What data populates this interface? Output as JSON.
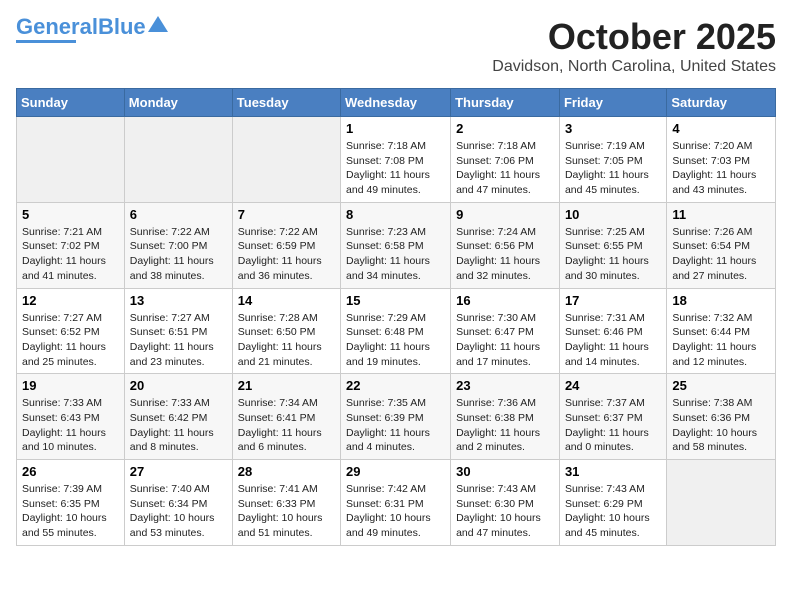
{
  "logo": {
    "part1": "General",
    "part2": "Blue"
  },
  "title": "October 2025",
  "subtitle": "Davidson, North Carolina, United States",
  "weekdays": [
    "Sunday",
    "Monday",
    "Tuesday",
    "Wednesday",
    "Thursday",
    "Friday",
    "Saturday"
  ],
  "weeks": [
    [
      {
        "num": "",
        "info": ""
      },
      {
        "num": "",
        "info": ""
      },
      {
        "num": "",
        "info": ""
      },
      {
        "num": "1",
        "info": "Sunrise: 7:18 AM\nSunset: 7:08 PM\nDaylight: 11 hours and 49 minutes."
      },
      {
        "num": "2",
        "info": "Sunrise: 7:18 AM\nSunset: 7:06 PM\nDaylight: 11 hours and 47 minutes."
      },
      {
        "num": "3",
        "info": "Sunrise: 7:19 AM\nSunset: 7:05 PM\nDaylight: 11 hours and 45 minutes."
      },
      {
        "num": "4",
        "info": "Sunrise: 7:20 AM\nSunset: 7:03 PM\nDaylight: 11 hours and 43 minutes."
      }
    ],
    [
      {
        "num": "5",
        "info": "Sunrise: 7:21 AM\nSunset: 7:02 PM\nDaylight: 11 hours and 41 minutes."
      },
      {
        "num": "6",
        "info": "Sunrise: 7:22 AM\nSunset: 7:00 PM\nDaylight: 11 hours and 38 minutes."
      },
      {
        "num": "7",
        "info": "Sunrise: 7:22 AM\nSunset: 6:59 PM\nDaylight: 11 hours and 36 minutes."
      },
      {
        "num": "8",
        "info": "Sunrise: 7:23 AM\nSunset: 6:58 PM\nDaylight: 11 hours and 34 minutes."
      },
      {
        "num": "9",
        "info": "Sunrise: 7:24 AM\nSunset: 6:56 PM\nDaylight: 11 hours and 32 minutes."
      },
      {
        "num": "10",
        "info": "Sunrise: 7:25 AM\nSunset: 6:55 PM\nDaylight: 11 hours and 30 minutes."
      },
      {
        "num": "11",
        "info": "Sunrise: 7:26 AM\nSunset: 6:54 PM\nDaylight: 11 hours and 27 minutes."
      }
    ],
    [
      {
        "num": "12",
        "info": "Sunrise: 7:27 AM\nSunset: 6:52 PM\nDaylight: 11 hours and 25 minutes."
      },
      {
        "num": "13",
        "info": "Sunrise: 7:27 AM\nSunset: 6:51 PM\nDaylight: 11 hours and 23 minutes."
      },
      {
        "num": "14",
        "info": "Sunrise: 7:28 AM\nSunset: 6:50 PM\nDaylight: 11 hours and 21 minutes."
      },
      {
        "num": "15",
        "info": "Sunrise: 7:29 AM\nSunset: 6:48 PM\nDaylight: 11 hours and 19 minutes."
      },
      {
        "num": "16",
        "info": "Sunrise: 7:30 AM\nSunset: 6:47 PM\nDaylight: 11 hours and 17 minutes."
      },
      {
        "num": "17",
        "info": "Sunrise: 7:31 AM\nSunset: 6:46 PM\nDaylight: 11 hours and 14 minutes."
      },
      {
        "num": "18",
        "info": "Sunrise: 7:32 AM\nSunset: 6:44 PM\nDaylight: 11 hours and 12 minutes."
      }
    ],
    [
      {
        "num": "19",
        "info": "Sunrise: 7:33 AM\nSunset: 6:43 PM\nDaylight: 11 hours and 10 minutes."
      },
      {
        "num": "20",
        "info": "Sunrise: 7:33 AM\nSunset: 6:42 PM\nDaylight: 11 hours and 8 minutes."
      },
      {
        "num": "21",
        "info": "Sunrise: 7:34 AM\nSunset: 6:41 PM\nDaylight: 11 hours and 6 minutes."
      },
      {
        "num": "22",
        "info": "Sunrise: 7:35 AM\nSunset: 6:39 PM\nDaylight: 11 hours and 4 minutes."
      },
      {
        "num": "23",
        "info": "Sunrise: 7:36 AM\nSunset: 6:38 PM\nDaylight: 11 hours and 2 minutes."
      },
      {
        "num": "24",
        "info": "Sunrise: 7:37 AM\nSunset: 6:37 PM\nDaylight: 11 hours and 0 minutes."
      },
      {
        "num": "25",
        "info": "Sunrise: 7:38 AM\nSunset: 6:36 PM\nDaylight: 10 hours and 58 minutes."
      }
    ],
    [
      {
        "num": "26",
        "info": "Sunrise: 7:39 AM\nSunset: 6:35 PM\nDaylight: 10 hours and 55 minutes."
      },
      {
        "num": "27",
        "info": "Sunrise: 7:40 AM\nSunset: 6:34 PM\nDaylight: 10 hours and 53 minutes."
      },
      {
        "num": "28",
        "info": "Sunrise: 7:41 AM\nSunset: 6:33 PM\nDaylight: 10 hours and 51 minutes."
      },
      {
        "num": "29",
        "info": "Sunrise: 7:42 AM\nSunset: 6:31 PM\nDaylight: 10 hours and 49 minutes."
      },
      {
        "num": "30",
        "info": "Sunrise: 7:43 AM\nSunset: 6:30 PM\nDaylight: 10 hours and 47 minutes."
      },
      {
        "num": "31",
        "info": "Sunrise: 7:43 AM\nSunset: 6:29 PM\nDaylight: 10 hours and 45 minutes."
      },
      {
        "num": "",
        "info": ""
      }
    ]
  ]
}
